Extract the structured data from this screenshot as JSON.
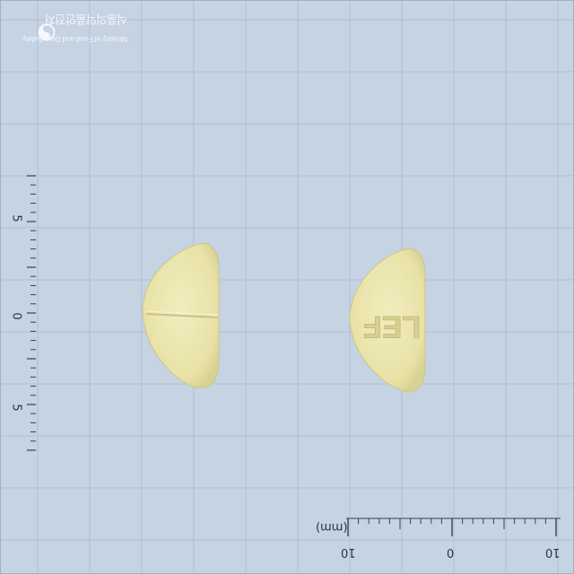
{
  "logo": {
    "org_korean": "식품의약품안전처",
    "org_english": "Ministry of Food and Drug Safety"
  },
  "pill": {
    "imprint_back": "",
    "imprint_front": "LEF",
    "color": "#ece7b2"
  },
  "ruler": {
    "unit_label": "(mm)",
    "horizontal_ticks": [
      "10",
      "0",
      "10"
    ],
    "vertical_ticks": [
      "5",
      "0",
      "5"
    ]
  },
  "colors": {
    "background": "#c5d3e3",
    "grid_major": "#aebfd4",
    "grid_minor": "#b8c8da",
    "ruler": "#3a3f4a"
  }
}
